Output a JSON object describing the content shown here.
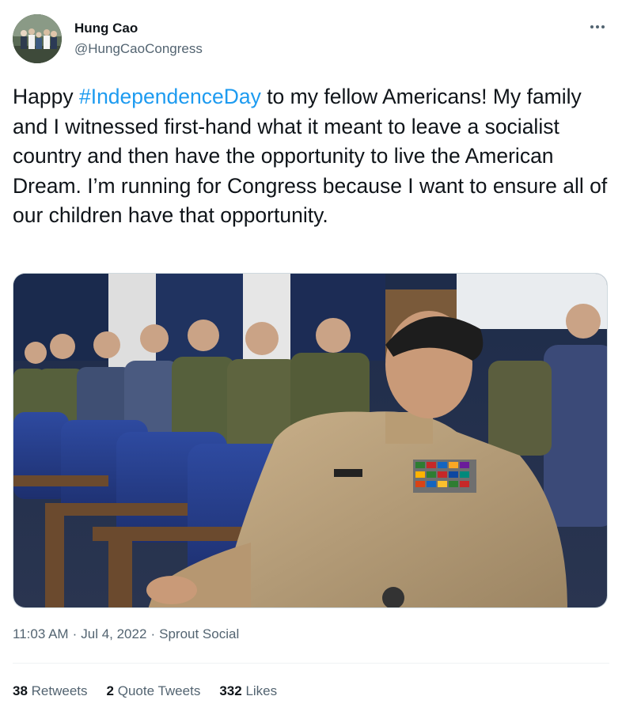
{
  "author": {
    "name": "Hung Cao",
    "handle": "@HungCaoCongress"
  },
  "tweet": {
    "prefix": "Happy ",
    "hashtag": "#IndependenceDay",
    "body": " to my fellow Americans! My family and I witnessed first-hand what it meant to leave a socialist country and then have the opportunity to live the American Dream. I’m running for Congress because I want to ensure all of our children have that opportunity."
  },
  "meta": {
    "time": "11:03 AM",
    "date": "Jul 4, 2022",
    "source": "Sprout Social",
    "separator": "·"
  },
  "stats": {
    "retweets": {
      "count": "38",
      "label": "Retweets"
    },
    "quotes": {
      "count": "2",
      "label": "Quote Tweets"
    },
    "likes": {
      "count": "332",
      "label": "Likes"
    }
  },
  "icons": {
    "more": "more-horizontal-icon"
  },
  "colors": {
    "accent": "#1d9bf0",
    "text": "#0f1419",
    "secondary": "#536471"
  }
}
